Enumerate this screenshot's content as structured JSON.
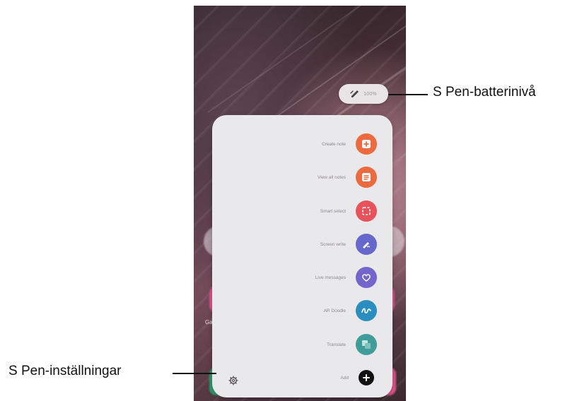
{
  "callouts": {
    "battery_level": "S Pen-batterinivå",
    "settings": "S Pen-inställningar"
  },
  "status": {
    "battery_percent": "100%"
  },
  "air_command": {
    "items": [
      {
        "label": "Create note",
        "icon": "create-note-icon",
        "color": "#ec6a3f"
      },
      {
        "label": "View all notes",
        "icon": "view-notes-icon",
        "color": "#ec6a3f"
      },
      {
        "label": "Smart select",
        "icon": "smart-select-icon",
        "color": "#e8525a"
      },
      {
        "label": "Screen write",
        "icon": "screen-write-icon",
        "color": "#6567cc"
      },
      {
        "label": "Live messages",
        "icon": "live-messages-icon",
        "color": "#7265cc"
      },
      {
        "label": "AR Doodle",
        "icon": "ar-doodle-icon",
        "color": "#2a8fbf"
      },
      {
        "label": "Translate",
        "icon": "translate-icon",
        "color": "#3f9c9a"
      },
      {
        "label": "Add",
        "icon": "add-icon",
        "color": "#111111"
      }
    ],
    "settings_icon": "gear-icon"
  },
  "background_apps": {
    "left_label": "Ga",
    "right_label": "e"
  }
}
